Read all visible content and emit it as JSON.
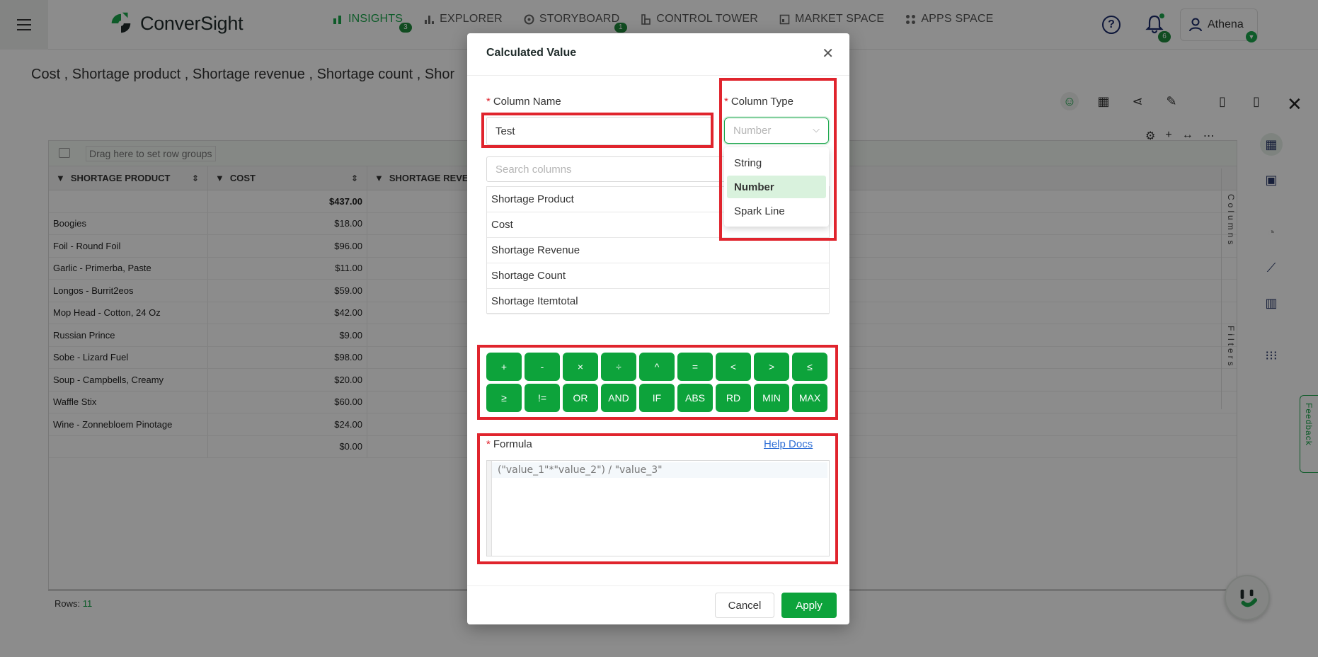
{
  "brand": {
    "name": "ConverSight",
    "color_primary": "#1aa64b",
    "color_dark": "#1f8a3c"
  },
  "nav": [
    {
      "label": "INSIGHTS",
      "icon": "bar-chart-icon",
      "badge": "3",
      "active": true
    },
    {
      "label": "EXPLORER",
      "icon": "explorer-bars-icon",
      "badge": "",
      "active": false
    },
    {
      "label": "STORYBOARD",
      "icon": "storyboard-gauge-icon",
      "badge": "1",
      "active": false
    },
    {
      "label": "CONTROL TOWER",
      "icon": "tower-icon",
      "badge": "",
      "active": false
    },
    {
      "label": "MARKET SPACE",
      "icon": "market-icon",
      "badge": "",
      "active": false
    },
    {
      "label": "APPS SPACE",
      "icon": "apps-grid-icon",
      "badge": "",
      "active": false
    }
  ],
  "header": {
    "notifications_count": "6",
    "user_name": "Athena"
  },
  "page": {
    "breadcrumb": "Cost , Shortage product , Shortage revenue , Shortage count , Shor"
  },
  "grid": {
    "group_placeholder": "Drag here to set row groups",
    "columns": [
      "SHORTAGE PRODUCT",
      "COST",
      "SHORTAGE REVE"
    ],
    "total_row": [
      "",
      "$437.00"
    ],
    "rows": [
      [
        "Boogies",
        "$18.00"
      ],
      [
        "Foil - Round Foil",
        "$96.00"
      ],
      [
        "Garlic - Primerba, Paste",
        "$11.00"
      ],
      [
        "Longos - Burrit2eos",
        "$59.00"
      ],
      [
        "Mop Head - Cotton, 24 Oz",
        "$42.00"
      ],
      [
        "Russian Prince",
        "$9.00"
      ],
      [
        "Sobe - Lizard Fuel",
        "$98.00"
      ],
      [
        "Soup - Campbells, Creamy",
        "$20.00"
      ],
      [
        "Waffle Stix",
        "$60.00"
      ],
      [
        "Wine - Zonnebloem Pinotage",
        "$24.00"
      ],
      [
        "",
        "$0.00"
      ]
    ],
    "side_columns_label": "Columns",
    "side_filters_label": "Filters",
    "footer_label": "Rows:",
    "footer_count": "11"
  },
  "feedback_label": "Feedback",
  "modal": {
    "title": "Calculated Value",
    "column_name_label": "Column Name",
    "column_name_value": "Test",
    "column_type_label": "Column Type",
    "column_type_placeholder": "Number",
    "column_type_options": [
      "String",
      "Number",
      "Spark Line"
    ],
    "column_type_selected": "Number",
    "search_placeholder": "Search columns",
    "columns": [
      "Shortage Product",
      "Cost",
      "Shortage Revenue",
      "Shortage Count",
      "Shortage Itemtotal"
    ],
    "operators": [
      "+",
      "-",
      "×",
      "÷",
      "^",
      "=",
      "<",
      ">",
      "≤",
      "≥",
      "!=",
      "OR",
      "AND",
      "IF",
      "ABS",
      "RD",
      "MIN",
      "MAX"
    ],
    "formula_label": "Formula",
    "help_docs_label": "Help Docs",
    "formula_value": "(\"value_1\"*\"value_2\") / \"value_3\"",
    "cancel_label": "Cancel",
    "apply_label": "Apply"
  },
  "highlight_color": "#e0242d"
}
